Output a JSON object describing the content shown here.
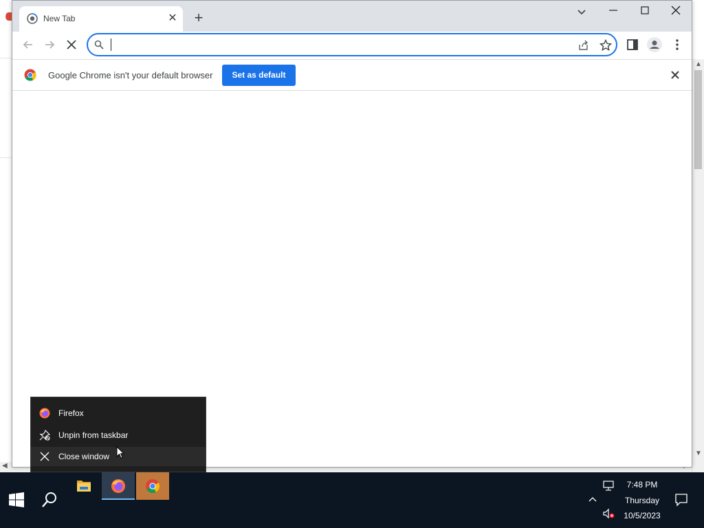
{
  "browser": {
    "tab": {
      "title": "New Tab",
      "favicon": "new-tab-icon"
    },
    "toolbar": {
      "address_value": ""
    },
    "infobar": {
      "message": "Google Chrome isn't your default browser",
      "button_label": "Set as default"
    }
  },
  "jumplist": {
    "items": [
      {
        "label": "Firefox",
        "icon": "firefox-icon"
      },
      {
        "label": "Unpin from taskbar",
        "icon": "unpin-icon"
      },
      {
        "label": "Close window",
        "icon": "close-icon"
      }
    ]
  },
  "taskbar": {
    "pinned": [
      "file-explorer-icon",
      "firefox-icon",
      "chrome-icon"
    ],
    "clock": {
      "time": "7:48 PM",
      "day": "Thursday",
      "date": "10/5/2023"
    }
  },
  "colors": {
    "accent": "#1a73e8",
    "taskbar_bg": "#0c1622",
    "jumplist_bg": "#1f1f1f",
    "chrome_taskbar_active": "#c0783c"
  }
}
